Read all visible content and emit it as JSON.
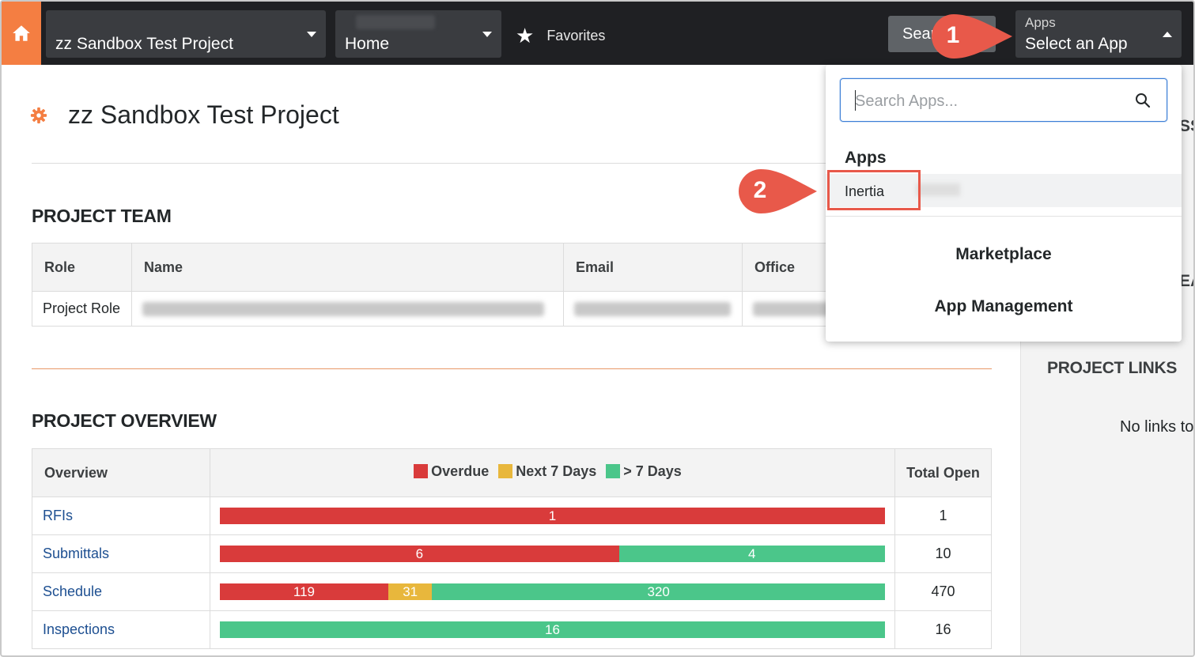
{
  "topbar": {
    "project_selector": "zz Sandbox Test Project",
    "tool_selector": "Home",
    "favorites_label": "Favorites",
    "search_label": "Search",
    "apps_label": "Apps",
    "apps_value": "Select an App"
  },
  "page": {
    "title": "zz Sandbox Test Project"
  },
  "team": {
    "section_title": "PROJECT TEAM",
    "headers": [
      "Role",
      "Name",
      "Email",
      "Office"
    ],
    "rows": [
      {
        "role": "Project Role"
      }
    ]
  },
  "overview": {
    "section_title": "PROJECT OVERVIEW",
    "headers": {
      "overview": "Overview",
      "total": "Total Open"
    },
    "legend": [
      {
        "label": "Overdue",
        "color": "#d93b3b"
      },
      {
        "label": "Next 7 Days",
        "color": "#e8b73c"
      },
      {
        "label": "> 7 Days",
        "color": "#4bc68a"
      }
    ],
    "rows": [
      {
        "name": "RFIs",
        "overdue": 1,
        "next7": 0,
        "later": 0,
        "total": "1"
      },
      {
        "name": "Submittals",
        "overdue": 6,
        "next7": 0,
        "later": 4,
        "total": "10"
      },
      {
        "name": "Schedule",
        "overdue": 119,
        "next7": 31,
        "later": 320,
        "total": "470"
      },
      {
        "name": "Inspections",
        "overdue": 0,
        "next7": 0,
        "later": 16,
        "total": "16"
      }
    ]
  },
  "right_panel": {
    "links_title": "PROJECT LINKS",
    "no_links_text": "No links to"
  },
  "apps_popup": {
    "search_placeholder": "Search Apps...",
    "apps_heading": "Apps",
    "app_items": [
      "Inertia"
    ],
    "marketplace_label": "Marketplace",
    "app_management_label": "App Management"
  },
  "callouts": [
    "1",
    "2"
  ],
  "colors": {
    "topbar_bg": "#1f2023",
    "home_accent": "#f47e42",
    "callout": "#e8594a",
    "link_blue": "#1d4f91"
  }
}
